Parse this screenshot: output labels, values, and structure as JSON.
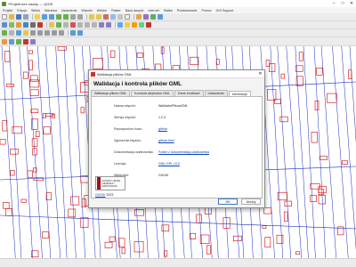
{
  "window": {
    "title": "*Projekt bez nazwy — QGIS"
  },
  "menu": [
    "Projekt",
    "Edycja",
    "Widok",
    "Warstwa",
    "Ustawienia",
    "Wtyczki",
    "Wektor",
    "Raster",
    "Baza danych",
    "Internet",
    "Siatka",
    "Przetwarzanie",
    "Pomoc",
    "GIS Support"
  ],
  "statusbar": {
    "text": ""
  },
  "dialog": {
    "window_title": "Walidacja plików GML",
    "heading": "Walidacja i kontrola plików GML",
    "tabs": [
      "Walidacja plików GML",
      "Kontrola atrybutów GML",
      "Dane źródłowe",
      "Ustawienia",
      "Informacje"
    ],
    "active_tab": "Informacje",
    "info": [
      {
        "label": "Nazwa wtyczki:",
        "value": "WalidatorPlikowGML",
        "link": false
      },
      {
        "label": "Wersja wtyczki:",
        "value": "1.2.4",
        "link": false
      },
      {
        "label": "Repozytorium kodu:",
        "value": "github",
        "link": true
      },
      {
        "label": "Zgłoszenie błędów:",
        "value": "github.html",
        "link": true
      },
      {
        "label": "Dokumentacja użytkownika:",
        "value": "Folder z dokumentacją użytkownika",
        "link": true
      },
      {
        "label": "Licencja:",
        "value": "GNU GPL v3.0",
        "link": true
      },
      {
        "label": "Właściciel:",
        "value": "GUGiK",
        "link": false
      }
    ],
    "logo_text": "GŁÓWNY URZĄD GEODEZJI I KARTOGRAFII",
    "footer_link": "GUGiK",
    "footer_year": "2023",
    "ok_label": "OK",
    "cancel_label": "Anuluj"
  },
  "colors": {
    "parcel_red": "#d40000",
    "parcel_blue": "#1a2fbf"
  }
}
